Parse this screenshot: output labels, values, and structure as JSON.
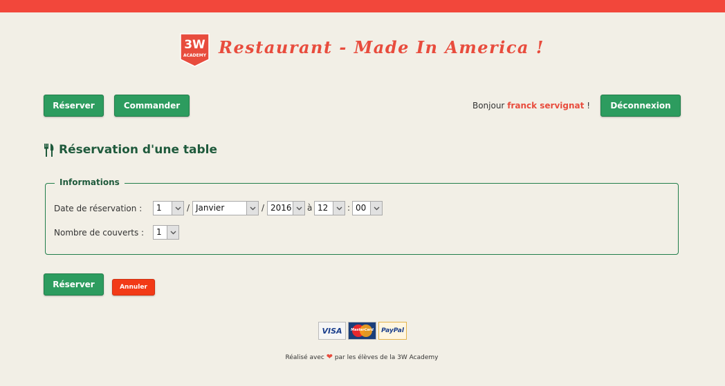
{
  "header": {
    "logo_text_top": "3W",
    "logo_text_bottom": "ACADEMY",
    "title": "Restaurant - Made In America !"
  },
  "nav": {
    "reserve_label": "Réserver",
    "order_label": "Commander",
    "greeting_prefix": "Bonjour",
    "user_name": "franck servignat",
    "greeting_suffix": "!",
    "logout_label": "Déconnexion"
  },
  "page": {
    "title": "Réservation d'une table"
  },
  "form": {
    "legend": "Informations",
    "date_label": "Date de réservation :",
    "day": "1",
    "month": "Janvier",
    "year": "2016",
    "date_sep": "/",
    "time_sep_a": "à",
    "hour": "12",
    "time_sep_colon": ":",
    "minute": "00",
    "covers_label": "Nombre de couverts :",
    "covers": "1",
    "submit_label": "Réserver",
    "cancel_label": "Annuler"
  },
  "footer": {
    "payments": [
      "VISA",
      "MasterCard",
      "PayPal"
    ],
    "text_before": "Réalisé avec",
    "text_after": "par les élèves de la 3W Academy"
  },
  "colors": {
    "accent_red": "#e84c3d",
    "button_green": "#2d9c5f",
    "title_green": "#1f5a3c",
    "cancel_red": "#f23a17"
  }
}
